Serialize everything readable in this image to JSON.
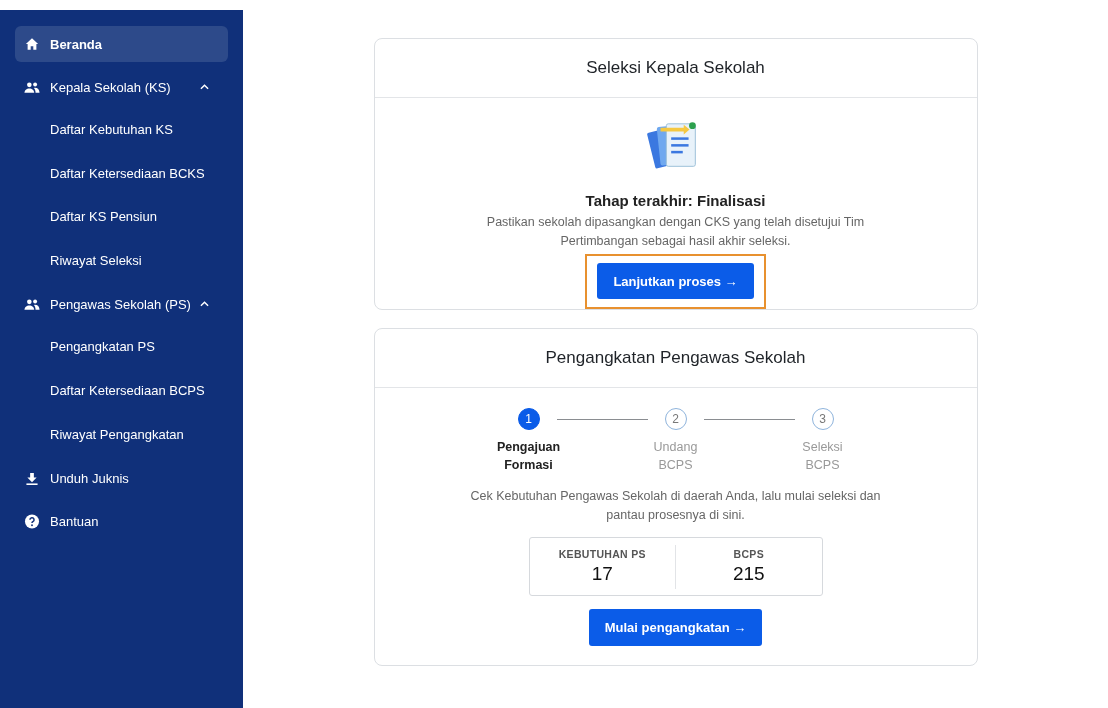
{
  "sidebar": {
    "items": [
      {
        "label": "Beranda",
        "kind": "home",
        "selected": true
      },
      {
        "label": "Kepala Sekolah (KS)",
        "kind": "people",
        "selected": false,
        "expanded": true,
        "children": [
          {
            "label": "Daftar Kebutuhan KS",
            "selected": false
          },
          {
            "label": "Daftar Ketersediaan BCKS",
            "selected": false
          },
          {
            "label": "Daftar KS Pensiun",
            "selected": false
          },
          {
            "label": "Riwayat Seleksi",
            "selected": false
          }
        ]
      },
      {
        "label": "Pengawas Sekolah (PS)",
        "kind": "people",
        "selected": false,
        "expanded": true,
        "children": [
          {
            "label": "Pengangkatan PS",
            "selected": false
          },
          {
            "label": "Daftar Ketersediaan BCPS",
            "selected": false
          },
          {
            "label": "Riwayat Pengangkatan",
            "selected": false
          }
        ]
      },
      {
        "label": "Unduh Juknis",
        "kind": "download",
        "selected": false
      },
      {
        "label": "Bantuan",
        "kind": "help",
        "selected": false
      }
    ]
  },
  "selection_card": {
    "title": "Seleksi Kepala Sekolah",
    "heading": "Tahap terakhir: Finalisasi",
    "description": "Pastikan sekolah dipasangkan dengan CKS yang telah disetujui Tim Pertimbangan sebagai hasil akhir seleksi.",
    "button": {
      "label": "Lanjutkan proses →",
      "highlighted": true
    }
  },
  "appointment_card": {
    "title": "Pengangkatan Pengawas Sekolah",
    "steps": [
      {
        "number": "1",
        "label": "Pengajuan Formasi",
        "selected": true
      },
      {
        "number": "2",
        "label": "Undang BCPS",
        "selected": false
      },
      {
        "number": "3",
        "label": "Seleksi BCPS",
        "selected": false
      }
    ],
    "description": "Cek Kebutuhan Pengawas Sekolah di daerah Anda, lalu mulai seleksi dan pantau prosesnya di sini.",
    "stats": [
      {
        "label": "KEBUTUHAN PS",
        "value": "17"
      },
      {
        "label": "BCPS",
        "value": "215"
      }
    ],
    "button": {
      "label": "Mulai pengangkatan →"
    }
  }
}
